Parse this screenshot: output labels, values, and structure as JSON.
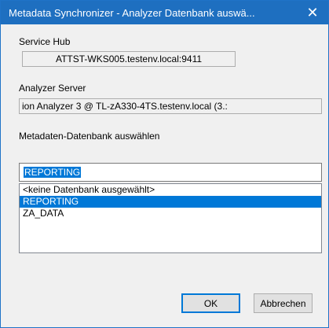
{
  "window": {
    "title": "Metadata Synchronizer - Analyzer Datenbank auswä...",
    "close_glyph": "✕"
  },
  "service_hub": {
    "label": "Service Hub",
    "value": "ATTST-WKS005.testenv.local:9411"
  },
  "analyzer_server": {
    "label": "Analyzer Server",
    "value": "ion Analyzer 3 @ TL-zA330-4TS.testenv.local (3.:"
  },
  "database_select": {
    "label": "Metadaten-Datenbank auswählen",
    "input_value": "REPORTING",
    "options": [
      "<keine Datenbank ausgewählt>",
      "REPORTING",
      "ZA_DATA"
    ],
    "selected_index": 1
  },
  "buttons": {
    "ok": "OK",
    "cancel": "Abbrechen"
  },
  "colors": {
    "titlebar": "#1e6fc0",
    "selection": "#0078d7"
  }
}
